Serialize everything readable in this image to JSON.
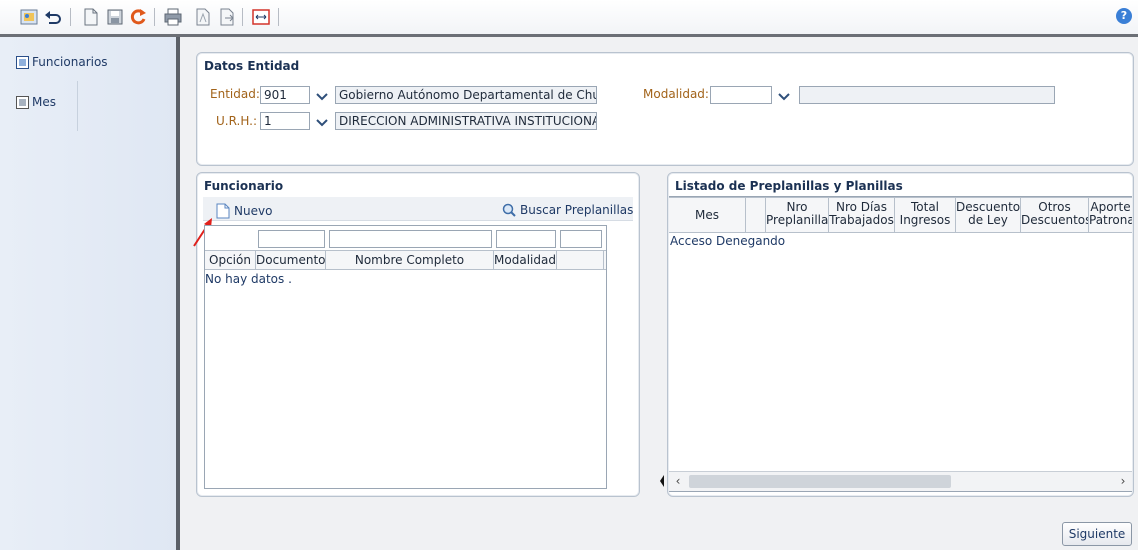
{
  "toolbar": {
    "icons": [
      "image-icon",
      "undo-icon",
      "new-doc-icon",
      "save-icon",
      "refresh-icon",
      "print-icon",
      "pdf-icon",
      "export-icon",
      "wide-icon"
    ],
    "help_label": "?"
  },
  "sidebar": {
    "items": [
      {
        "label": "Funcionarios"
      },
      {
        "label": "Mes"
      }
    ]
  },
  "datos_entidad": {
    "title": "Datos Entidad",
    "entidad_label": "Entidad:",
    "entidad_code": "901",
    "entidad_name": "Gobierno Autónomo Departamental de Chuqui",
    "urh_label": "U.R.H.:",
    "urh_code": "1",
    "urh_name": "DIRECCION ADMINISTRATIVA INSTITUCIONA",
    "modalidad_label": "Modalidad:",
    "modalidad_code": "",
    "modalidad_name": ""
  },
  "funcionario": {
    "title": "Funcionario",
    "new_label": "Nuevo",
    "search_label": "Buscar Preplanillas",
    "columns": [
      "Opción",
      "Documento",
      "Nombre Completo",
      "Modalidad",
      ""
    ],
    "empty_message": "No hay datos ."
  },
  "listado": {
    "title": "Listado de Preplanillas y Planillas",
    "columns": [
      {
        "l1": "Mes",
        "l2": ""
      },
      {
        "l1": "",
        "l2": ""
      },
      {
        "l1": "Nro",
        "l2": "Preplanilla"
      },
      {
        "l1": "Nro Días",
        "l2": "Trabajados"
      },
      {
        "l1": "Total",
        "l2": "Ingresos"
      },
      {
        "l1": "Descuentos",
        "l2": "de Ley"
      },
      {
        "l1": "Otros",
        "l2": "Descuentos"
      },
      {
        "l1": "Aporte",
        "l2": "Patronal"
      }
    ],
    "message": "Acceso Denegando"
  },
  "footer": {
    "next_label": "Siguiente"
  },
  "colors": {
    "title": "#1b3153",
    "label": "#a2631a",
    "accent": "#3a7fd6"
  }
}
